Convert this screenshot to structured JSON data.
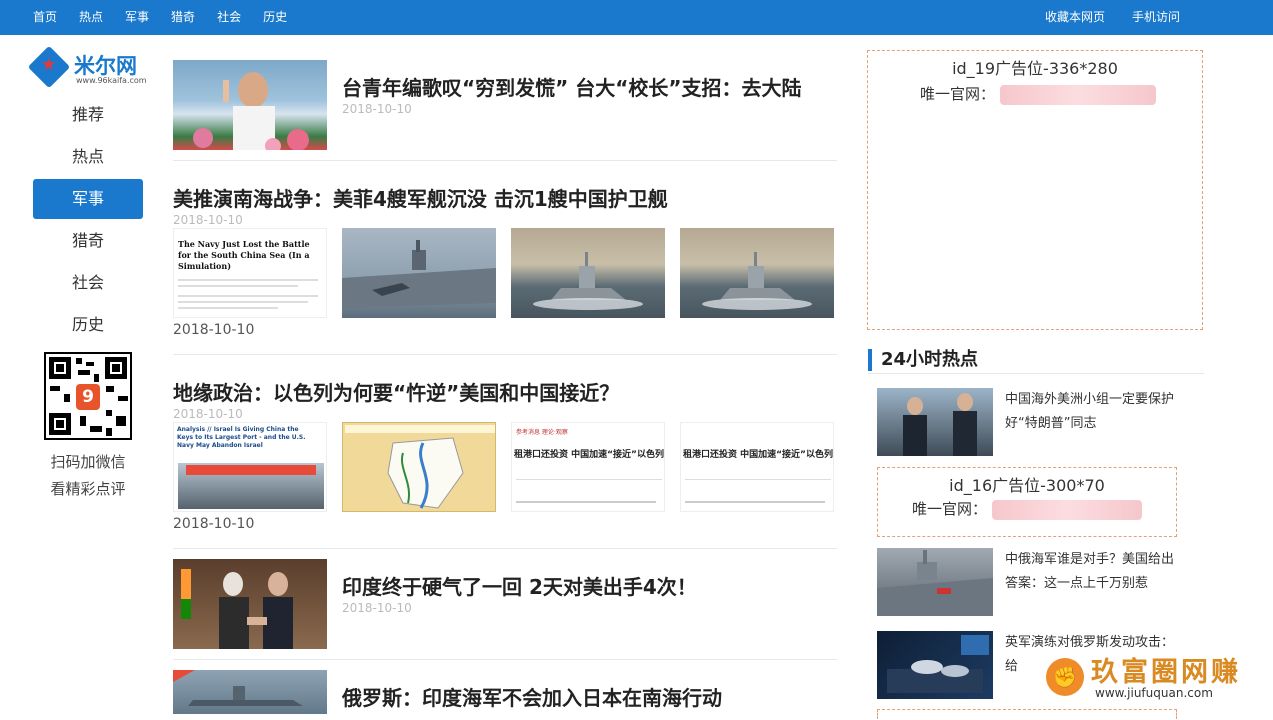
{
  "top_nav": [
    "首页",
    "热点",
    "军事",
    "猎奇",
    "社会",
    "历史"
  ],
  "top_right": [
    "收藏本网页",
    "手机访问"
  ],
  "logo": {
    "name": "米尔网",
    "url": "www.96kaifa.com"
  },
  "side_nav": [
    {
      "label": "推荐",
      "active": false
    },
    {
      "label": "热点",
      "active": false
    },
    {
      "label": "军事",
      "active": true
    },
    {
      "label": "猎奇",
      "active": false
    },
    {
      "label": "社会",
      "active": false
    },
    {
      "label": "历史",
      "active": false
    }
  ],
  "qr": {
    "line1": "扫码加微信",
    "line2": "看精彩点评"
  },
  "articles": [
    {
      "title": "台青年编歌叹“穷到发慌” 台大“校长”支招：去大陆",
      "date": "2018-10-10"
    },
    {
      "title": "美推演南海战争：美菲4艘军舰沉没 击沉1艘中国护卫舰",
      "date": "2018-10-10",
      "date2": "2018-10-10"
    },
    {
      "title": "地缘政治：以色列为何要“忤逆”美国和中国接近？",
      "date": "2018-10-10",
      "date2": "2018-10-10"
    },
    {
      "title": "印度终于硬气了一回 2天对美出手4次！",
      "date": "2018-10-10"
    },
    {
      "title": "俄罗斯：印度海军不会加入日本在南海行动"
    }
  ],
  "thumb_text": {
    "navy_headline": "The Navy Just Lost the Battle for the South China Sea (In a Simulation)",
    "israel_headline": "Analysis // Israel Is Giving China the Keys to Its Largest Port - and the U.S. Navy May Abandon Israel",
    "china_caption": "租港口还投资 中国加速“接近”以色列有何玄机?",
    "china_logo": "参考消息 理论·观察",
    "china_caption_2": "租港口还投资 中国加速“接近”以色列有何玄机?"
  },
  "ads": [
    {
      "title": "id_19广告位-336*280",
      "label": "唯一官网："
    },
    {
      "title": "id_16广告位-300*70",
      "label": "唯一官网："
    }
  ],
  "hot": {
    "heading": "24小时热点",
    "items": [
      {
        "title": "中国海外美洲小组一定要保护好“特朗普”同志"
      },
      {
        "title": "中俄海军谁是对手？美国给出答案：这一点上千万别惹"
      },
      {
        "title": "英军演练对俄罗斯发动攻击：给"
      }
    ]
  },
  "watermark": {
    "text": "玖富圈网赚",
    "url": "www.jiufuquan.com",
    "icon": "fist-icon"
  },
  "colors": {
    "primary": "#1a79cc",
    "ad_border": "#e8a070",
    "watermark": "#d98a22"
  }
}
